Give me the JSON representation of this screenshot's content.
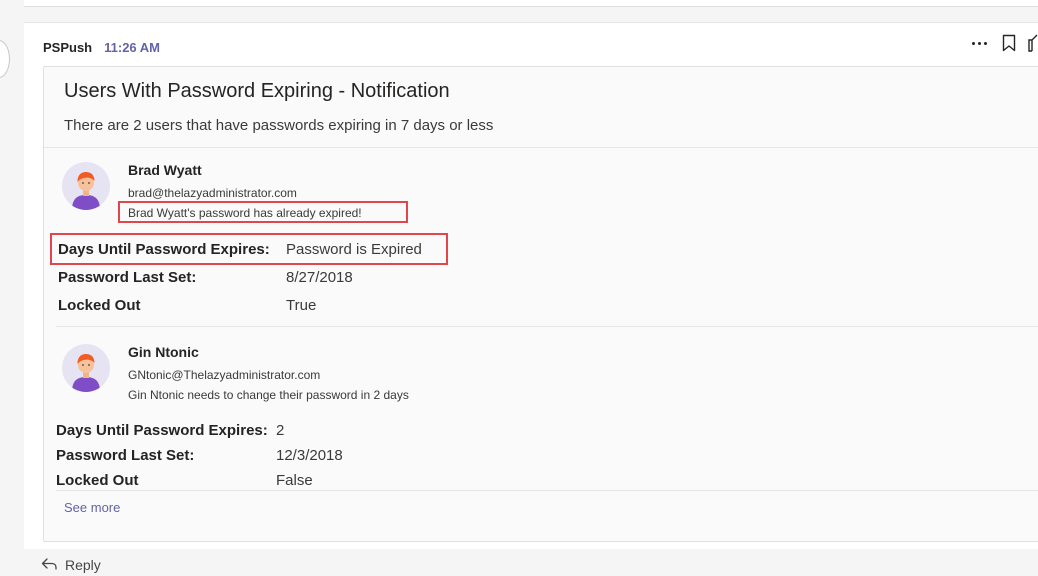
{
  "post": {
    "sender": "PSPush",
    "time": "11:26 AM"
  },
  "card": {
    "title": "Users With Password Expiring - Notification",
    "subtitle": "There are 2 users that have passwords expiring in 7 days or less",
    "see_more": "See more"
  },
  "users": [
    {
      "name": "Brad Wyatt",
      "email": "brad@thelazyadministrator.com",
      "message": "Brad Wyatt's password has already expired!",
      "facts": [
        {
          "label": "Days Until Password Expires:",
          "value": "Password is Expired"
        },
        {
          "label": "Password Last Set:",
          "value": "8/27/2018"
        },
        {
          "label": "Locked Out",
          "value": "True"
        }
      ]
    },
    {
      "name": "Gin Ntonic",
      "email": "GNtonic@Thelazyadministrator.com",
      "message": "Gin Ntonic needs to change their password in 2 days",
      "facts": [
        {
          "label": "Days Until Password Expires:",
          "value": "2"
        },
        {
          "label": "Password Last Set:",
          "value": "12/3/2018"
        },
        {
          "label": "Locked Out",
          "value": "False"
        }
      ]
    }
  ],
  "reply": {
    "label": "Reply"
  },
  "colors": {
    "accent": "#6264a7",
    "highlight_box": "#e0474c",
    "avatar_bg": "#e6e3f3"
  },
  "icons": [
    "more-options-icon",
    "bookmark-icon",
    "like-icon",
    "reply-arrow-icon",
    "user-avatar-icon"
  ]
}
